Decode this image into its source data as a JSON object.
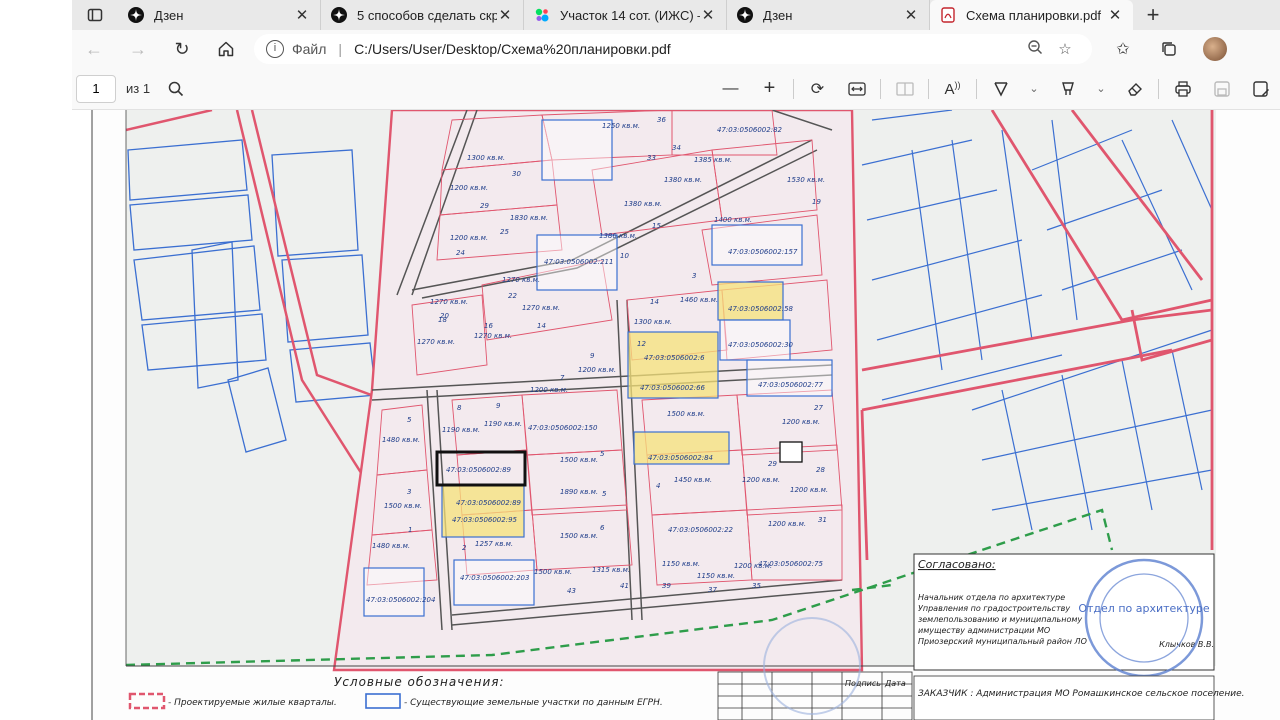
{
  "tabs": [
    {
      "title": "Дзен",
      "icon": "dzen-icon",
      "active": false
    },
    {
      "title": "5 способов сделать скри",
      "icon": "dzen-icon",
      "active": false
    },
    {
      "title": "Участок 14 сот. (ИЖС) —",
      "icon": "avito-icon",
      "active": false
    },
    {
      "title": "Дзен",
      "icon": "dzen-icon",
      "active": false
    },
    {
      "title": "Схема планировки.pdf",
      "icon": "pdf-icon",
      "active": true
    }
  ],
  "address": {
    "scheme": "Файл",
    "path": "C:/Users/User/Desktop/Схема%20планировки.pdf"
  },
  "pdf_toolbar": {
    "page": "1",
    "page_count": "из 1"
  },
  "plan": {
    "lots": [
      {
        "area": "1250 кв.м.",
        "num": "36"
      },
      {
        "area": "1300 кв.м.",
        "num": "30"
      },
      {
        "area": "1200 кв.м.",
        "num": "29"
      },
      {
        "area": "1830 кв.м.",
        "num": "25"
      },
      {
        "area": "1200 кв.м.",
        "num": "24"
      },
      {
        "area": "1385 кв.м.",
        "num": "34"
      },
      {
        "area": "1380 кв.м.",
        "num": "33"
      },
      {
        "area": "1380 кв.м.",
        "num": "15"
      },
      {
        "area": "1386 кв.м.",
        "num": "10"
      },
      {
        "area": "1270 кв.м.",
        "num": "22"
      },
      {
        "area": "1270 кв.м.",
        "num": "14"
      },
      {
        "area": "1270 кв.м.",
        "num": "20"
      },
      {
        "area": "1270 кв.м.",
        "num": "18"
      },
      {
        "area": "1270 кв.м.",
        "num": "16"
      },
      {
        "area": "1530 кв.м.",
        "num": "19"
      },
      {
        "area": "1400 кв.м.",
        "num": "3"
      },
      {
        "area": "1460 кв.м.",
        "num": "14"
      },
      {
        "area": "1300 кв.м.",
        "num": "12"
      },
      {
        "area": "1200 кв.м.",
        "num": "9"
      },
      {
        "area": "1200 кв.м.",
        "num": "7"
      },
      {
        "area": "1500 кв.м.",
        "num": "8"
      },
      {
        "area": "1190 кв.м.",
        "num": "8"
      },
      {
        "area": "1190 кв.м.",
        "num": "9"
      },
      {
        "area": "1480 кв.м.",
        "num": "5"
      },
      {
        "area": "1500 кв.м.",
        "num": "3"
      },
      {
        "area": "1480 кв.м.",
        "num": "1"
      },
      {
        "area": "1500 кв.м.",
        "num": "5"
      },
      {
        "area": "1890 кв.м.",
        "num": "5"
      },
      {
        "area": "1500 кв.м.",
        "num": "6"
      },
      {
        "area": "1257 кв.м.",
        "num": "2"
      },
      {
        "area": "1500 кв.м.",
        "num": "43"
      },
      {
        "area": "1315 кв.м.",
        "num": "41"
      },
      {
        "area": "1450 кв.м.",
        "num": "4"
      },
      {
        "area": "1200 кв.м.",
        "num": "29"
      },
      {
        "area": "1200 кв.м.",
        "num": "27"
      },
      {
        "area": "1200 кв.м.",
        "num": "28"
      },
      {
        "area": "1200 кв.м.",
        "num": "31"
      },
      {
        "area": "1150 кв.м.",
        "num": "39"
      },
      {
        "area": "1150 кв.м.",
        "num": "37"
      },
      {
        "area": "1200 кв.м.",
        "num": "35"
      }
    ],
    "cadastral": [
      "47:03:0506002:89",
      "47:03:0506002:82",
      "47:03:0506002:211",
      "47:03:0506002:157",
      "47:03:0506002:58",
      "47:03:0506002:30",
      "47:03:0506002:6",
      "47:03:0506002:66",
      "47:03:0506002:77",
      "47:03:0506002:150",
      "47:03:0506002:84",
      "47:03:0506002:89",
      "47:03:0506002:95",
      "47:03:0506002:22",
      "47:03:0506002:203",
      "47:03:0506002:204",
      "47:03:0506002:75"
    ]
  },
  "legend": {
    "title": "Условные обозначения:",
    "items": [
      "- Проектируемые жилые кварталы.",
      "- Существующие земельные участки по данным ЕГРН."
    ]
  },
  "approval": {
    "heading": "Согласовано:",
    "lines": [
      "Начальник отдела по архитектуре",
      "Управления по градостроительству",
      "землепользованию и муниципальному",
      "имуществу администрации МО",
      "Приозерский муниципальный район ЛО"
    ],
    "signer": "Клычков В.В.",
    "stamp": "Отдел по архитектуре"
  },
  "title_block": {
    "sign_label": "Подпись",
    "date_label": "Дата",
    "customer": "ЗАКАЗЧИК : Администрация МО Ромашкинское сельское поселение."
  },
  "colors": {
    "planned_red": "#e0566e",
    "existing_blue": "#3b6fd1",
    "highlight_yellow": "#f6e27a",
    "green_line": "#2e9d4a"
  }
}
